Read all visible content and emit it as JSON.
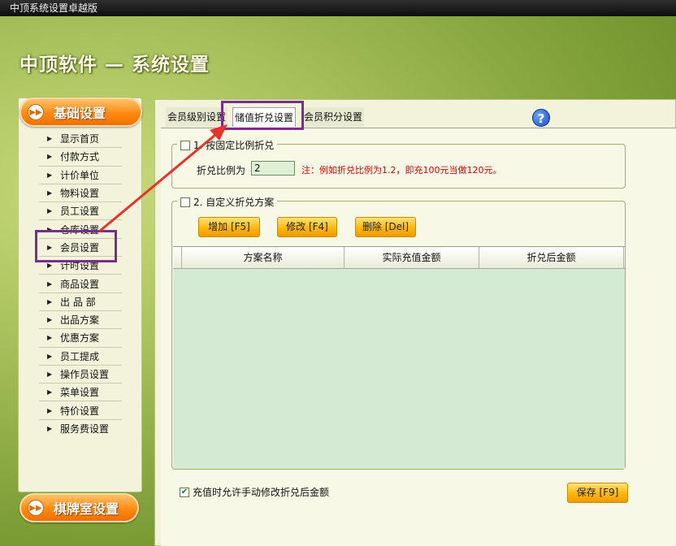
{
  "window": {
    "title": "中顶系统设置卓越版"
  },
  "header": {
    "title": "中顶软件 — 系统设置"
  },
  "sidebar": {
    "basic_label": "基础设置",
    "chess_label": "棋牌室设置",
    "items": [
      {
        "label": "显示首页"
      },
      {
        "label": "付款方式"
      },
      {
        "label": "计价单位"
      },
      {
        "label": "物料设置"
      },
      {
        "label": "员工设置"
      },
      {
        "label": "仓库设置"
      },
      {
        "label": "会员设置"
      },
      {
        "label": "计时设置"
      },
      {
        "label": "商品设置"
      },
      {
        "label": "出 品 部"
      },
      {
        "label": "出品方案"
      },
      {
        "label": "优惠方案"
      },
      {
        "label": "员工提成"
      },
      {
        "label": "操作员设置"
      },
      {
        "label": "菜单设置"
      },
      {
        "label": "特价设置"
      },
      {
        "label": "服务费设置"
      }
    ]
  },
  "tabs": [
    {
      "label": "会员级别设置"
    },
    {
      "label": "储值折兑设置"
    },
    {
      "label": "会员积分设置"
    }
  ],
  "section1": {
    "title": "1. 按固定比例折兑",
    "ratio_label": "折兑比例为",
    "ratio_value": "2",
    "note": "注：例如折兑比例为1.2，即充100元当做120元。"
  },
  "section2": {
    "title": "2. 自定义折兑方案",
    "add_button": "增加 [F5]",
    "edit_button": "修改 [F4]",
    "delete_button": "删除 [Del]",
    "columns": [
      "方案名称",
      "实际充值金额",
      "折兑后金额"
    ]
  },
  "footer": {
    "allow_manual_label": "充值时允许手动修改折兑后金额",
    "allow_manual_checked": true,
    "save_button": "保存 [F9]"
  },
  "colors": {
    "highlight": "#7a2d8f",
    "arrow": "#e8332a",
    "note": "#e00000"
  }
}
